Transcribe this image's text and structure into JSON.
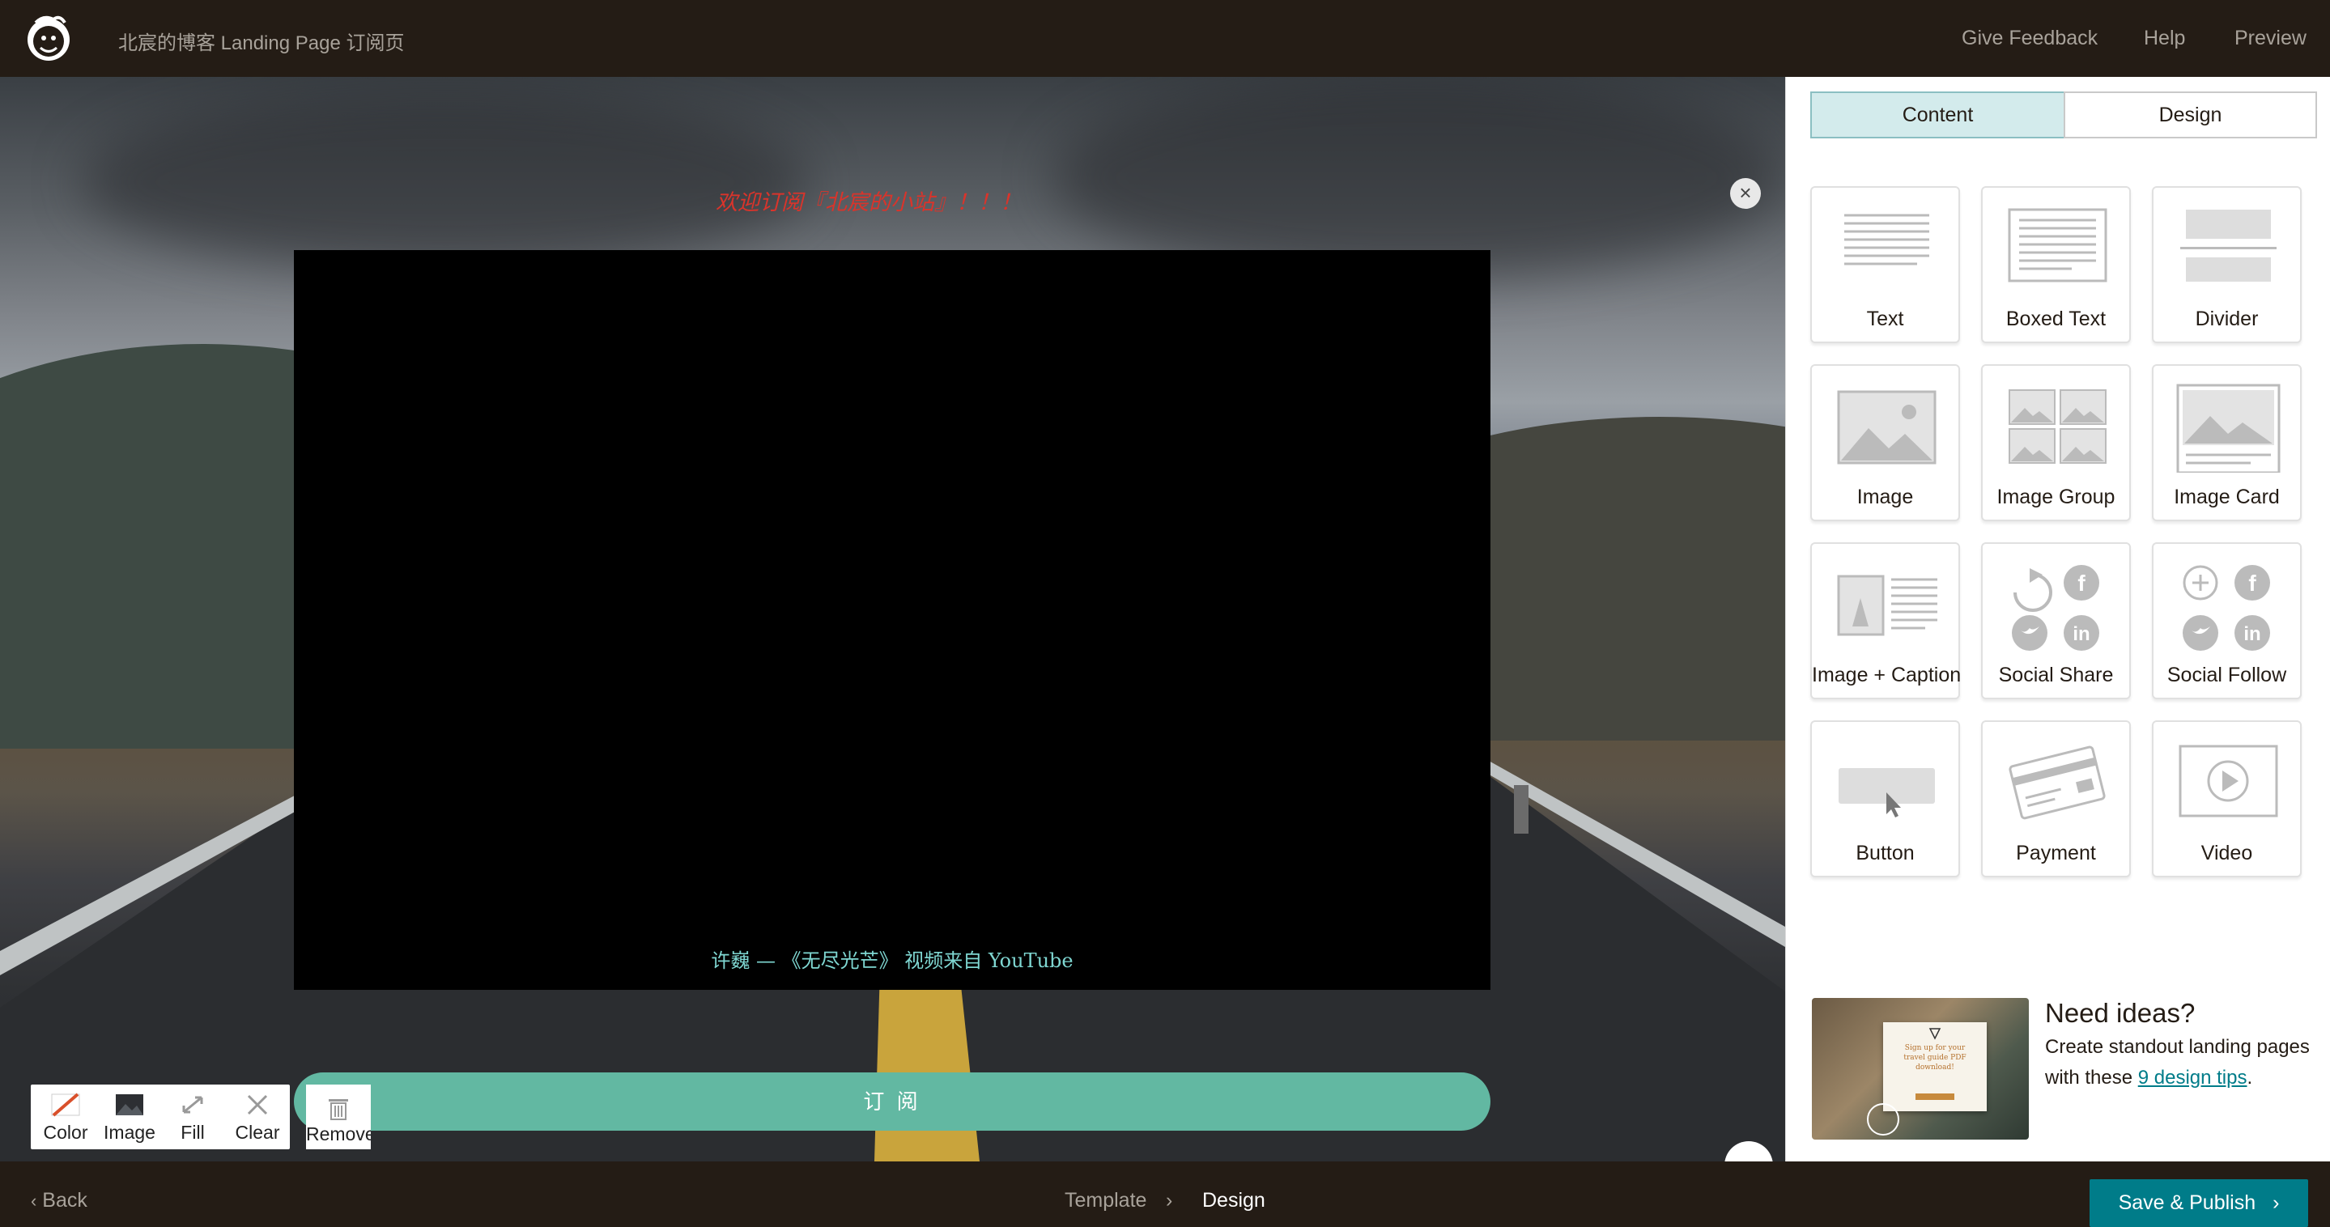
{
  "header": {
    "page_title": "北宸的博客 Landing Page 订阅页",
    "links": [
      "Give Feedback",
      "Help",
      "Preview"
    ]
  },
  "canvas": {
    "heading": "欢迎订阅『北宸的小站』！！！",
    "video_caption": "许巍 — 《无尽光芒》   视频来自 YouTube",
    "subscribe_button": "订 阅",
    "close_icon": "close-icon",
    "background_tools": [
      {
        "label": "Color",
        "icon": "color-slash-icon"
      },
      {
        "label": "Image",
        "icon": "image-thumb-icon"
      },
      {
        "label": "Fill",
        "icon": "fill-arrows-icon"
      },
      {
        "label": "Clear",
        "icon": "clear-x-icon"
      }
    ],
    "remove_tool": "Remove"
  },
  "panel": {
    "tabs": [
      {
        "label": "Content",
        "active": true
      },
      {
        "label": "Design",
        "active": false
      }
    ],
    "blocks": [
      {
        "label": "Text",
        "icon": "text-block-icon"
      },
      {
        "label": "Boxed Text",
        "icon": "boxed-text-icon"
      },
      {
        "label": "Divider",
        "icon": "divider-icon"
      },
      {
        "label": "Image",
        "icon": "image-icon"
      },
      {
        "label": "Image Group",
        "icon": "image-group-icon"
      },
      {
        "label": "Image Card",
        "icon": "image-card-icon"
      },
      {
        "label": "Image + Caption",
        "icon": "image-caption-icon"
      },
      {
        "label": "Social Share",
        "icon": "social-share-icon"
      },
      {
        "label": "Social Follow",
        "icon": "social-follow-icon"
      },
      {
        "label": "Button",
        "icon": "button-block-icon"
      },
      {
        "label": "Payment",
        "icon": "payment-icon"
      },
      {
        "label": "Video",
        "icon": "video-icon"
      }
    ],
    "ideas": {
      "title": "Need ideas?",
      "text": "Create standout landing pages with these ",
      "link": "9 design tips",
      "tail": ".",
      "image_card_text": "Sign up for your travel guide PDF download!"
    }
  },
  "footer": {
    "back": "Back",
    "crumbs": [
      "Template",
      "Design"
    ],
    "save": "Save & Publish"
  },
  "colors": {
    "header_bg": "#241c15",
    "heading_red": "#d9342b",
    "caption_teal": "#7fd7d2",
    "subscribe_green": "#62b8a2",
    "active_tab": "#d3ebec",
    "save_teal": "#007c89"
  }
}
